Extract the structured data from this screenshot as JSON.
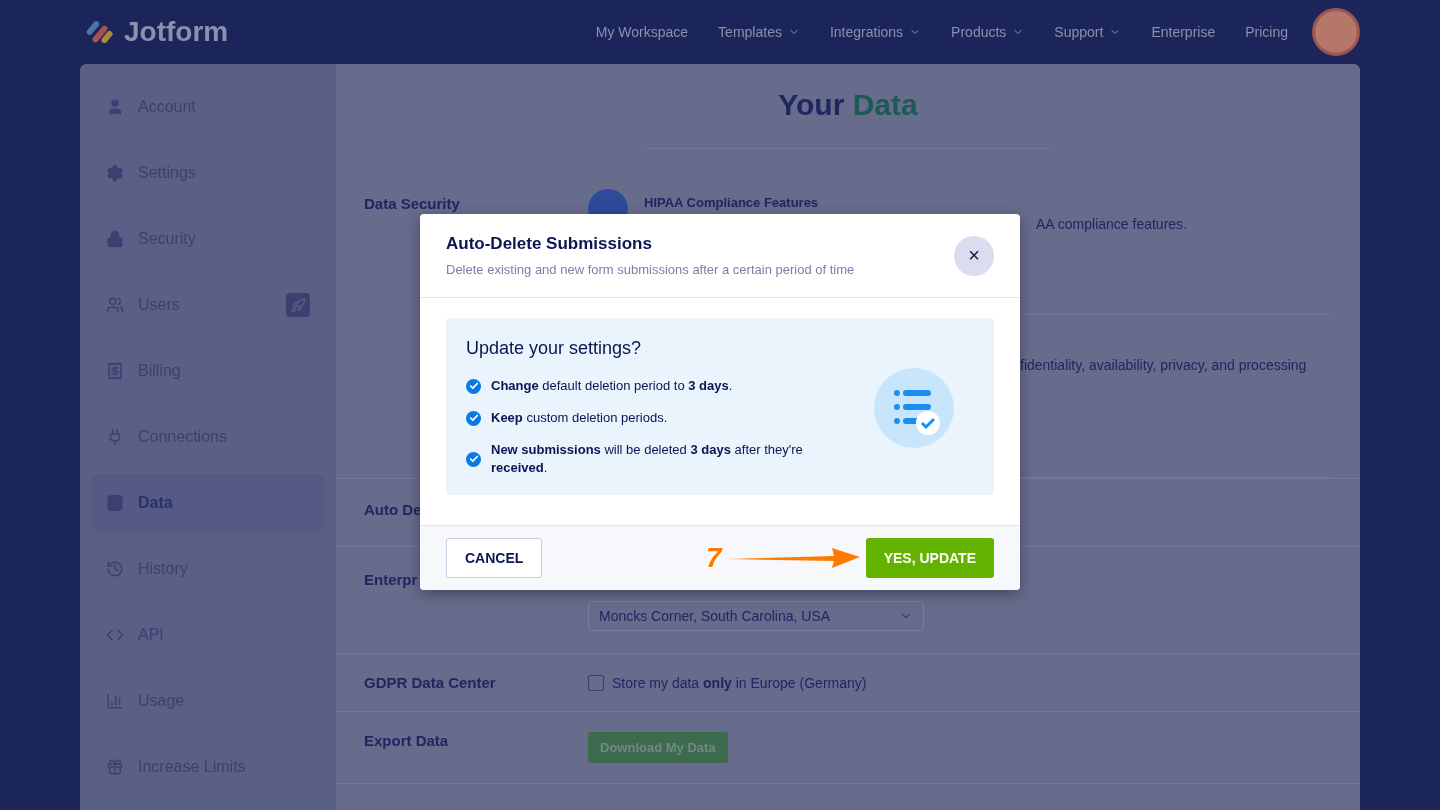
{
  "navbar": {
    "logo": "Jotform",
    "links": [
      {
        "label": "My Workspace",
        "dropdown": false
      },
      {
        "label": "Templates",
        "dropdown": true
      },
      {
        "label": "Integrations",
        "dropdown": true
      },
      {
        "label": "Products",
        "dropdown": true
      },
      {
        "label": "Support",
        "dropdown": true
      },
      {
        "label": "Enterprise",
        "dropdown": false
      },
      {
        "label": "Pricing",
        "dropdown": false
      }
    ]
  },
  "sidebar": {
    "items": [
      {
        "label": "Account",
        "selected": false,
        "badge": false
      },
      {
        "label": "Settings",
        "selected": false,
        "badge": false
      },
      {
        "label": "Security",
        "selected": false,
        "badge": false
      },
      {
        "label": "Users",
        "selected": false,
        "badge": true
      },
      {
        "label": "Billing",
        "selected": false,
        "badge": false
      },
      {
        "label": "Connections",
        "selected": false,
        "badge": false
      },
      {
        "label": "Data",
        "selected": true,
        "badge": false
      },
      {
        "label": "History",
        "selected": false,
        "badge": false
      },
      {
        "label": "API",
        "selected": false,
        "badge": false
      },
      {
        "label": "Usage",
        "selected": false,
        "badge": false
      },
      {
        "label": "Increase Limits",
        "selected": false,
        "badge": false
      }
    ]
  },
  "page": {
    "title": "Your",
    "title_accent": "Data",
    "data_security": {
      "label": "Data Security",
      "feature_title": "HIPAA Compliance Features",
      "feature_text": "AA compliance features.",
      "second_text": "fidentiality, availability, privacy, and processing"
    },
    "auto_delete": {
      "label": "Auto De"
    },
    "enterprise": {
      "label": "Enterpr",
      "location": "Moncks Corner, South Carolina, USA"
    },
    "gdpr": {
      "label": "GDPR Data Center",
      "checkbox_text": "Store my data **only** in Europe (Germany)",
      "checked": false
    },
    "export": {
      "label": "Export Data",
      "button": "Download My Data"
    }
  },
  "modal": {
    "title": "Auto-Delete Submissions",
    "subtitle": "Delete existing and new form submissions after a certain period of time",
    "close": "×",
    "question": "Update your settings?",
    "items": [
      {
        "text": "**Change** default deletion period to **3 days**.",
        "checked": true
      },
      {
        "text": "**Keep** custom deletion periods.",
        "checked": true
      },
      {
        "text": "**New submissions** will be deleted **3 days** after they're **received**.",
        "checked": true
      }
    ],
    "cancel": "CANCEL",
    "confirm": "YES, UPDATE"
  },
  "annotation": {
    "step": "7"
  }
}
